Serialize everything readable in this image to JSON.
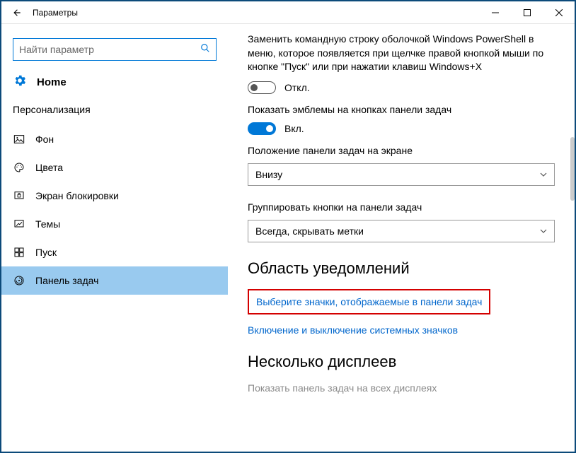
{
  "window": {
    "title": "Параметры"
  },
  "search": {
    "placeholder": "Найти параметр"
  },
  "home_label": "Home",
  "section_title": "Персонализация",
  "nav": [
    {
      "label": "Фон"
    },
    {
      "label": "Цвета"
    },
    {
      "label": "Экран блокировки"
    },
    {
      "label": "Темы"
    },
    {
      "label": "Пуск"
    },
    {
      "label": "Панель задач"
    }
  ],
  "content": {
    "powershell_desc": "Заменить командную строку оболочкой Windows PowerShell в меню, которое появляется при щелчке правой кнопкой мыши по кнопке \"Пуск\" или при нажатии клавиш Windows+X",
    "toggle_off_label": "Откл.",
    "badges_label": "Показать эмблемы на кнопках панели задач",
    "toggle_on_label": "Вкл.",
    "position_label": "Положение панели задач на экране",
    "position_value": "Внизу",
    "group_label": "Группировать кнопки на панели задач",
    "group_value": "Всегда, скрывать метки",
    "notification_area_heading": "Область уведомлений",
    "link_icons": "Выберите значки, отображаемые в панели задач",
    "link_system_icons": "Включение и выключение системных значков",
    "multiple_displays_heading": "Несколько дисплеев",
    "show_on_all": "Показать панель задач на всех дисплеях"
  }
}
